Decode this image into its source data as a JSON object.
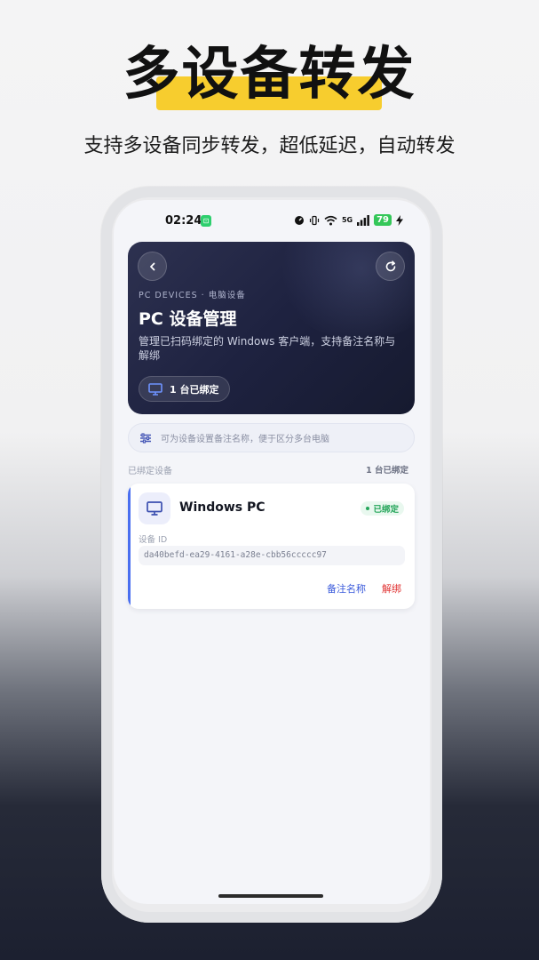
{
  "promo": {
    "title": "多设备转发",
    "subtitle": "支持多设备同步转发，超低延迟，自动转发"
  },
  "status_bar": {
    "time": "02:24",
    "app_badge": "⊡",
    "network": "5G",
    "battery": "79"
  },
  "hero": {
    "eyebrow": "PC DEVICES · 电脑设备",
    "title": "PC 设备管理",
    "description": "管理已扫码绑定的 Windows 客户端，支持备注名称与解绑",
    "pill_label": "1 台已绑定",
    "back_icon": "chevron-left-icon",
    "refresh_icon": "refresh-icon"
  },
  "tip": {
    "text": "可为设备设置备注名称，便于区分多台电脑",
    "icon": "sliders-icon"
  },
  "section": {
    "label": "已绑定设备",
    "count": "1 台已绑定"
  },
  "devices": [
    {
      "name": "Windows PC",
      "status": "已绑定",
      "id_label": "设备 ID",
      "id_value": "da40befd-ea29-4161-a28e-cbb56ccccc97",
      "rename_label": "备注名称",
      "unbind_label": "解绑"
    }
  ],
  "colors": {
    "accent": "#4a6ff0",
    "highlight": "#f7cd2e",
    "bound_green": "#25a55a",
    "danger": "#e03131"
  }
}
